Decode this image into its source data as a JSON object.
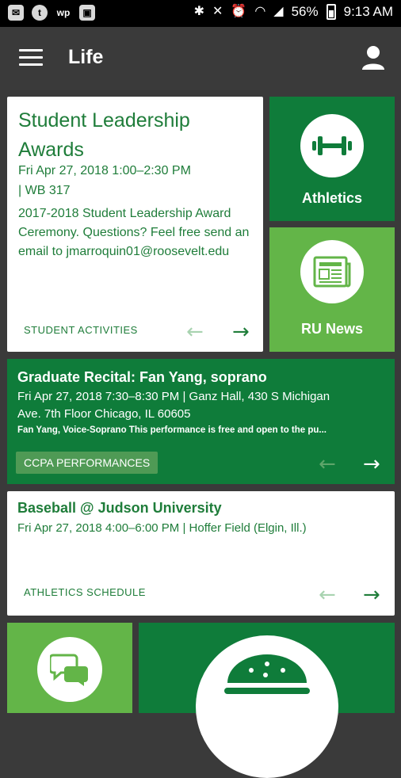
{
  "status_bar": {
    "battery": "56%",
    "time": "9:13 AM",
    "left_icons": [
      "message-icon",
      "tumblr-icon",
      "washington-post-icon",
      "image-icon"
    ],
    "right_icons": [
      "bluetooth-icon",
      "mute-icon",
      "alarm-icon",
      "wifi-icon",
      "signal-icon",
      "battery-icon"
    ]
  },
  "app_bar": {
    "title": "Life"
  },
  "featured_event": {
    "title": "Student Leadership Awards",
    "datetime": "Fri Apr 27, 2018 1:00–2:30 PM",
    "location": "| WB 317",
    "description": "2017-2018 Student Leadership Award Ceremony. Questions? Feel free send an email to jmarroquin01@roosevelt.edu",
    "category": "STUDENT ACTIVITIES"
  },
  "tiles": {
    "athletics": "Athletics",
    "news": "RU News"
  },
  "event_recital": {
    "title": "Graduate Recital: Fan Yang, soprano",
    "datetime_location": "Fri Apr 27, 2018 7:30–8:30 PM  | Ganz Hall, 430 S Michigan",
    "location_cont": "Ave. 7th Floor Chicago, IL 60605",
    "snippet": "Fan Yang, Voice-Soprano This performance is free and open to the pu...",
    "category": "CCPA PERFORMANCES"
  },
  "event_baseball": {
    "title": "Baseball @ Judson University",
    "datetime_location": "Fri Apr 27, 2018 4:00–6:00 PM  | Hoffer Field (Elgin, Ill.)",
    "category": "ATHLETICS SCHEDULE"
  },
  "colors": {
    "dark_green": "#0f7c3a",
    "light_green": "#63b548",
    "app_bar": "#3a3a3a"
  }
}
